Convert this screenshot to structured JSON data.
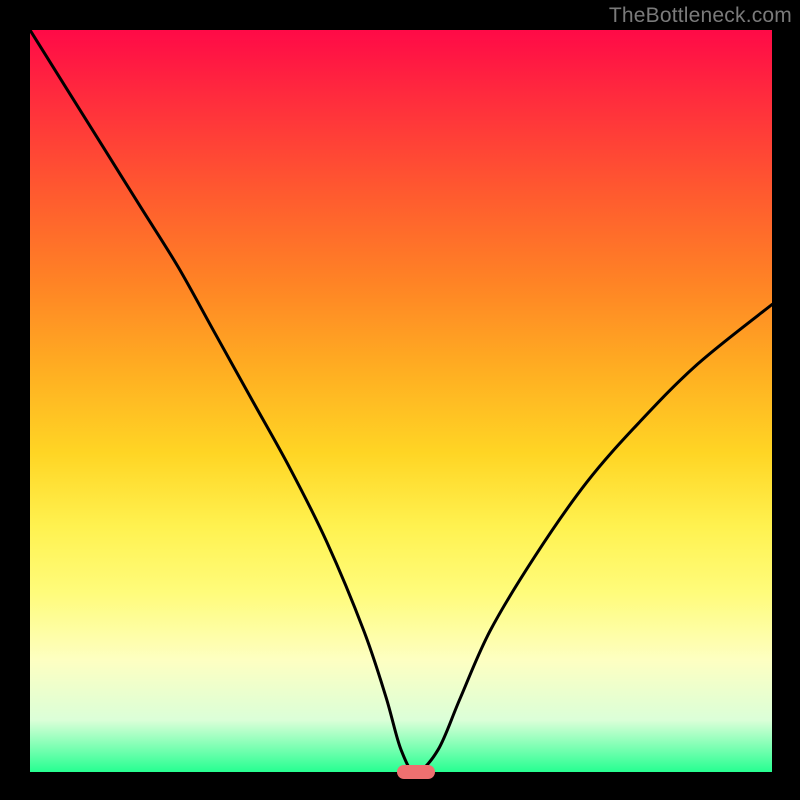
{
  "watermark": "TheBottleneck.com",
  "colors": {
    "frame": "#000000",
    "gradient_top": "#ff0a47",
    "gradient_bottom": "#26ff91",
    "curve": "#000000",
    "marker": "#ee7070"
  },
  "chart_data": {
    "type": "line",
    "title": "",
    "xlabel": "",
    "ylabel": "",
    "xlim": [
      0,
      100
    ],
    "ylim": [
      0,
      100
    ],
    "x": [
      0,
      5,
      10,
      15,
      20,
      25,
      30,
      35,
      40,
      45,
      48,
      50,
      52,
      55,
      58,
      62,
      68,
      75,
      82,
      90,
      100
    ],
    "values": [
      100,
      92,
      84,
      76,
      68,
      59,
      50,
      41,
      31,
      19,
      10,
      3,
      0,
      3,
      10,
      19,
      29,
      39,
      47,
      55,
      63
    ],
    "minimum": {
      "x": 52,
      "y": 0
    },
    "description": "V-shaped bottleneck curve; minimum ≈ 52% along x-axis at y ≈ 0; left arm rises to 100, right arm rises to ≈ 63."
  }
}
